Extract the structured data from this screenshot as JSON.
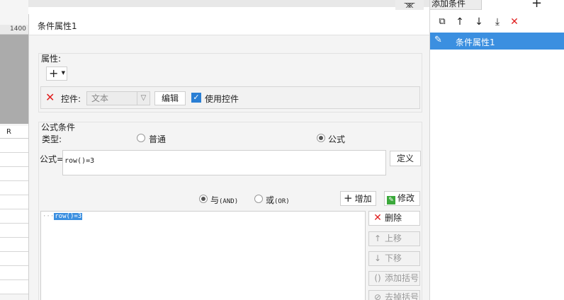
{
  "background": {
    "ruler_value": "1400",
    "column_header": "R",
    "canvas_color": "#ababab"
  },
  "dialog": {
    "title": "条件属性1",
    "property_group": {
      "legend": "属性:",
      "add_button": "+",
      "control_row": {
        "remove_icon": "close-icon",
        "label": "控件:",
        "control_type_value": "文本",
        "edit_button": "编辑",
        "use_control_checked": true,
        "use_control_label": "使用控件"
      }
    },
    "formula_group": {
      "legend": "公式条件",
      "type_label": "类型:",
      "type_normal_label": "普通",
      "type_formula_label": "公式",
      "selected_type": "formula",
      "formula_label": "公式=",
      "formula_value": "row()=3",
      "define_button": "定义",
      "and_label": "与",
      "and_suffix": "(AND)",
      "or_label": "或",
      "or_suffix": "(OR)",
      "selected_logic": "and",
      "add_button": "增加",
      "modify_button": "修改",
      "condition_prefix": "···",
      "condition_items": [
        "row()=3"
      ],
      "side_buttons": {
        "delete": "删除",
        "move_up": "上移",
        "move_down": "下移",
        "add_paren": "添加括号",
        "remove_paren": "去掉括号"
      }
    }
  },
  "right_panel": {
    "title": "添加条件",
    "add_symbol": "+",
    "entries": [
      "条件属性1"
    ],
    "selected_color": "#3b8fe0"
  },
  "top_strip_icon": "grid-icon",
  "accent_color": "#2a7fd4",
  "danger_color": "#e02020"
}
